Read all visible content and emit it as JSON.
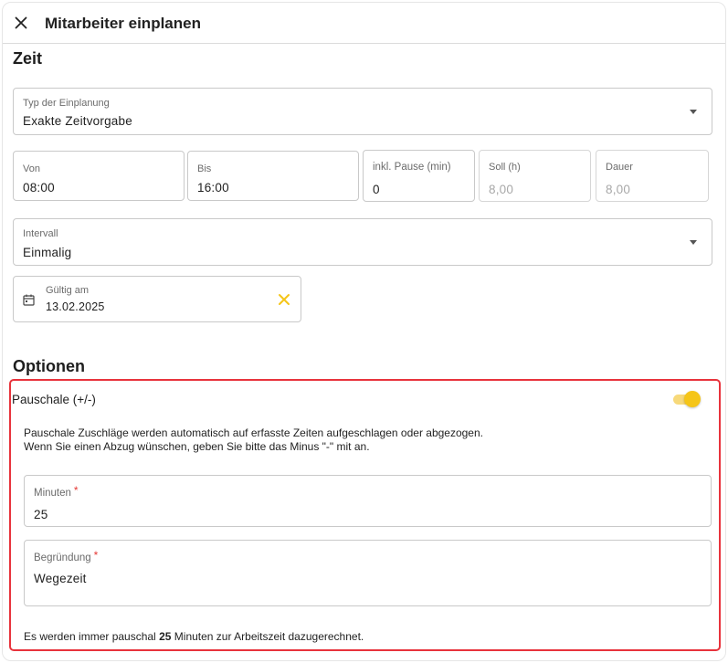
{
  "header": {
    "title": "Mitarbeiter einplanen"
  },
  "sections": {
    "time": "Zeit",
    "options": "Optionen"
  },
  "time": {
    "type": {
      "label": "Typ der Einplanung",
      "value": "Exakte Zeitvorgabe"
    },
    "from": {
      "label": "Von",
      "value": "08:00"
    },
    "to": {
      "label": "Bis",
      "value": "16:00"
    },
    "pause": {
      "label": "inkl. Pause (min)",
      "value": "0"
    },
    "target": {
      "label": "Soll (h)",
      "value": "8,00"
    },
    "duration": {
      "label": "Dauer",
      "value": "8,00"
    },
    "interval": {
      "label": "Intervall",
      "value": "Einmalig"
    },
    "valid": {
      "label": "Gültig am",
      "value": "13.02.2025"
    }
  },
  "options": {
    "flat": {
      "label": "Pauschale (+/-)",
      "enabled": true,
      "description_line1": "Pauschale Zuschläge werden automatisch auf erfasste Zeiten aufgeschlagen oder abgezogen.",
      "description_line2": "Wenn Sie einen Abzug wünschen, geben Sie bitte das Minus \"-\" mit an.",
      "minutes": {
        "label": "Minuten",
        "value": "25"
      },
      "reason": {
        "label": "Begründung",
        "value": "Wegezeit"
      },
      "summary_prefix": "Es werden immer pauschal",
      "summary_value": "25",
      "summary_suffix": "Minuten zur Arbeitszeit dazugerechnet."
    }
  },
  "required_mark": "*",
  "icons": {
    "close": "close-icon",
    "calendar": "calendar-icon",
    "clear": "clear-icon",
    "dropdown": "chevron-down-icon"
  },
  "colors": {
    "accent": "#f5c518",
    "highlight": "#e8333c"
  }
}
